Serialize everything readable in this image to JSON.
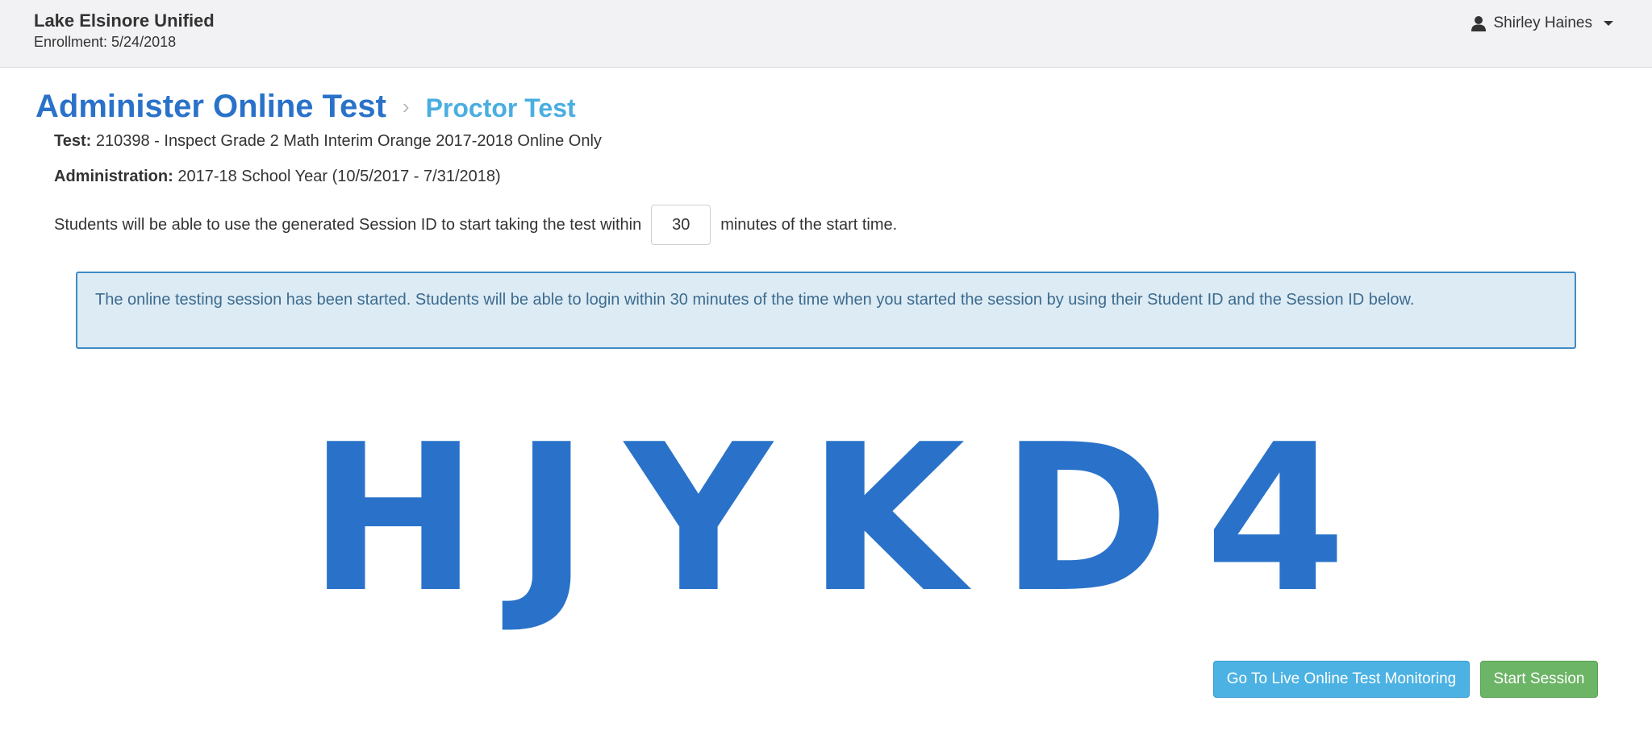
{
  "header": {
    "org_name": "Lake Elsinore Unified",
    "enrollment": "Enrollment: 5/24/2018",
    "user_name": "Shirley Haines"
  },
  "title": {
    "main": "Administer Online Test",
    "separator": "›",
    "breadcrumb": "Proctor Test"
  },
  "details": {
    "test_label": "Test:",
    "test_value": " 210398 - Inspect Grade 2 Math Interim Orange 2017-2018 Online Only",
    "admin_label": "Administration:",
    "admin_value": " 2017-18 School Year (10/5/2017 - 7/31/2018)",
    "window_prefix": "Students will be able to use the generated Session ID to start taking the test within",
    "window_minutes": "30",
    "window_suffix": "minutes of the start time."
  },
  "alert": {
    "message": "The online testing session has been started. Students will be able to login within 30 minutes of the time when you started the session by using their Student ID and the Session ID below."
  },
  "session": {
    "code": "HJYKD4"
  },
  "buttons": {
    "monitor": "Go To Live Online Test Monitoring",
    "start": "Start Session"
  },
  "colors": {
    "accent_blue": "#2a72c9",
    "crumb_blue": "#4aaee0",
    "alert_bg": "#dcebf4",
    "button_info": "#4bb2e3",
    "button_success": "#6cb466"
  }
}
